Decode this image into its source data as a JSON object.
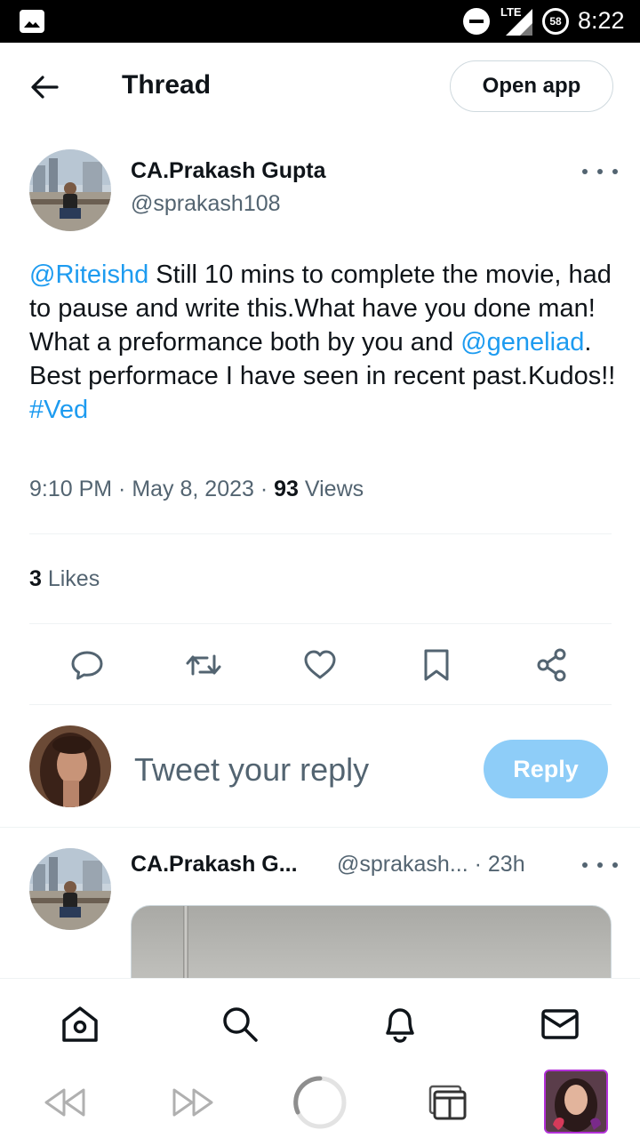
{
  "status_bar": {
    "network": "LTE",
    "battery_level": "58",
    "time": "8:22"
  },
  "header": {
    "title": "Thread",
    "open_app_label": "Open app"
  },
  "tweet": {
    "author_name": "CA.Prakash Gupta",
    "author_handle": "@sprakash108",
    "mention_1": "@Riteishd",
    "text_1": " Still 10 mins to complete the movie, had to pause and write this.What have you done man! What a preformance both by you and ",
    "mention_2": "@geneliad",
    "text_2": ". Best performace I have seen in recent past.Kudos!! ",
    "hashtag": "#Ved",
    "time": "9:10 PM",
    "date": "May 8, 2023",
    "views_count": "93",
    "views_label": " Views",
    "likes_count": "3",
    "likes_label": " Likes"
  },
  "reply_composer": {
    "placeholder": "Tweet your reply",
    "button_label": "Reply"
  },
  "reply_tweet": {
    "author_name": "CA.Prakash G...",
    "author_handle": "@sprakash...",
    "age": "· 23h"
  },
  "colors": {
    "link": "#1d9bf0",
    "reply_button": "#8ecdf8",
    "secondary_text": "#536471",
    "browser_accent": "#b230d8"
  },
  "icons": {
    "header": [
      "arrow-left-icon"
    ],
    "actions": [
      "reply-icon",
      "retweet-icon",
      "like-icon",
      "bookmark-icon",
      "share-icon"
    ],
    "bottom_nav": [
      "home-icon",
      "search-icon",
      "notifications-icon",
      "messages-icon"
    ],
    "browser": [
      "back-icon",
      "forward-icon",
      "reload-icon",
      "tabs-icon",
      "profile-avatar"
    ]
  }
}
